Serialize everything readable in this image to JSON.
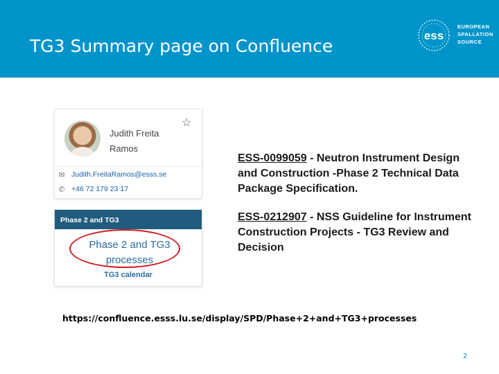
{
  "slide": {
    "title": "TG3 Summary page on Confluence",
    "page_number": "2"
  },
  "logo": {
    "mark": "ess",
    "lines": [
      "EUROPEAN",
      "SPALLATION",
      "SOURCE"
    ]
  },
  "profile_card": {
    "name_line1": "Judith Freita",
    "name_line2": "Ramos",
    "email": "Judith.FreitaRamos@esss.se",
    "phone": "+46 72 179 23 17"
  },
  "phase_card": {
    "header": "Phase 2 and TG3",
    "link_line1": "Phase 2 and TG3",
    "link_line2": "processes",
    "calendar": "TG3 calendar"
  },
  "documents": [
    {
      "id": "ESS-0099059",
      "separator": " - ",
      "description": "Neutron Instrument Design and Construction -Phase 2 Technical Data Package Specification."
    },
    {
      "id": "ESS-0212907",
      "separator": " - ",
      "description": "NSS Guideline for Instrument Construction Projects - TG3 Review and Decision"
    }
  ],
  "url": "https://confluence.esss.lu.se/display/SPD/Phase+2+and+TG3+processes",
  "colors": {
    "header": "#0094ca",
    "card_header": "#215b7d",
    "link": "#2a6da0",
    "highlight_circle": "#d6191d"
  },
  "icons": {
    "favourite": "star-icon",
    "email": "envelope-icon",
    "phone": "phone-icon"
  }
}
